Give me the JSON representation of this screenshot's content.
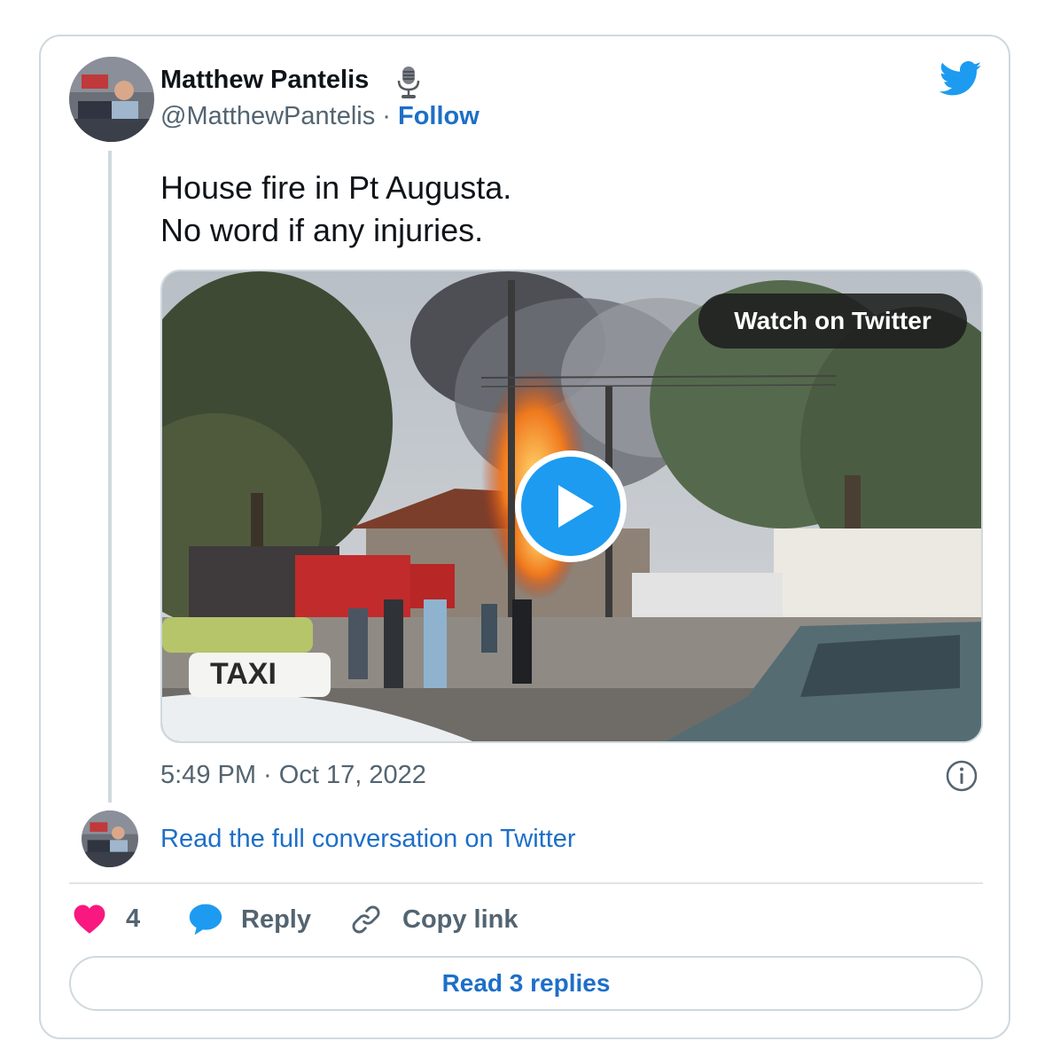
{
  "author": {
    "name": "Matthew Pantelis",
    "name_emoji_icon": "microphone-icon",
    "handle": "@MatthewPantelis",
    "separator": " · ",
    "follow_label": "Follow"
  },
  "tweet": {
    "lines": [
      "House fire in Pt Augusta.",
      "No word if any injuries."
    ],
    "timestamp": "5:49 PM · Oct 17, 2022"
  },
  "media": {
    "watch_label": "Watch on Twitter",
    "play_icon": "play-icon",
    "taxi_sign": "TAXI"
  },
  "conversation": {
    "read_full_label": "Read the full conversation on Twitter"
  },
  "actions": {
    "like_count": "4",
    "reply_label": "Reply",
    "copy_link_label": "Copy link",
    "read_replies_label": "Read 3 replies"
  },
  "colors": {
    "link": "#1d6fc8",
    "twitter_blue": "#1d9bf0",
    "like_pink": "#f91880",
    "border": "#cfd9de",
    "secondary_text": "#536471"
  }
}
